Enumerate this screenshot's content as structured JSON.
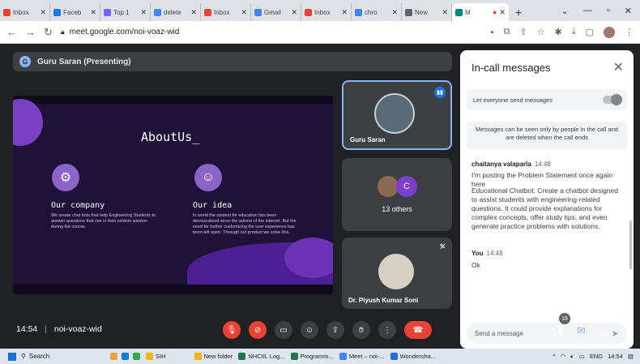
{
  "browser": {
    "tabs": [
      {
        "label": "Inbox",
        "color": "#ea4335"
      },
      {
        "label": "Faceb",
        "color": "#1877f2"
      },
      {
        "label": "Top 1",
        "color": "#7b61ff"
      },
      {
        "label": "delete",
        "color": "#4285f4"
      },
      {
        "label": "Inbox",
        "color": "#ea4335"
      },
      {
        "label": "Gmail",
        "color": "#4285f4"
      },
      {
        "label": "Inbox",
        "color": "#ea4335"
      },
      {
        "label": "chro",
        "color": "#4285f4"
      },
      {
        "label": "New",
        "color": "#5f6368"
      },
      {
        "label": "M",
        "color": "#00897b"
      }
    ],
    "url": "meet.google.com/noi-voaz-wid"
  },
  "meet": {
    "presenter_label": "Guru Saran (Presenting)",
    "presenter_initial": "G",
    "meeting_time": "14:54",
    "meeting_code": "noi-voaz-wid",
    "participant_count": "16"
  },
  "slide": {
    "title": "AboutUs_",
    "features": [
      {
        "title": "Our company",
        "text": "We create chat bots that help Engineering Students to answer questions that rise in their seldom wisdom during the course."
      },
      {
        "title": "Our idea",
        "text": "In world the content for education has been democratized since the advent of the internet. But the need for further customizing the user experience has been left open. Through our product we solve this."
      }
    ]
  },
  "tiles": {
    "guru": {
      "name": "Guru Saran"
    },
    "others": {
      "initial": "C",
      "label": "13 others"
    },
    "piyush": {
      "name": "Dr. Piyush Kumar Soni"
    }
  },
  "chat": {
    "header": "In-call messages",
    "setting_label": "Let everyone send messages",
    "notice": "Messages can be seen only by people in the call and are deleted when the call ends",
    "messages": [
      {
        "sender": "chaitanya valaparla",
        "time": "14:48",
        "lines": [
          "I'm posting the Problem Statement once again here",
          "Educational Chatbot: Create a chatbot designed to assist students with engineering-related questions. It could provide explanations for complex concepts, offer study tips, and even generate practice problems with solutions."
        ]
      },
      {
        "sender": "You",
        "time": "14:48",
        "lines": [
          "Ok"
        ]
      }
    ],
    "input_placeholder": "Send a message"
  },
  "taskbar": {
    "search_label": "Search",
    "apps": [
      {
        "label": "SIH",
        "color": "#f4b400"
      },
      {
        "label": "New folder",
        "color": "#f4b400"
      },
      {
        "label": "NHCIIL Log...",
        "color": "#217346"
      },
      {
        "label": "Programm...",
        "color": "#217346"
      },
      {
        "label": "Meet – noi-...",
        "color": "#4285f4"
      },
      {
        "label": "Wondersha...",
        "color": "#1e6fd9"
      }
    ],
    "lang": "ENG",
    "time": "14:54"
  }
}
